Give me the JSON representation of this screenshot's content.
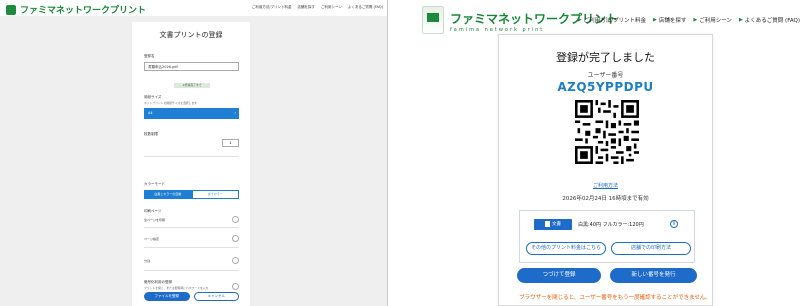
{
  "left": {
    "logo": "ファミマネットワークプリント",
    "nav": [
      "ご利用方法/プリント料金",
      "店舗を探す",
      "ご利用シーン",
      "よくあるご質問 (FAQ)"
    ],
    "title": "文書プリントの登録",
    "file_label": "登録名",
    "file_value": "書類申込2026.pdf",
    "notice": "※登録完了まで",
    "paper_label": "用紙サイズ",
    "paper_hint": "ネットプリントの用紙サイズを選択します",
    "paper_value": "A4",
    "copies_label": "枚数制限",
    "copies_value": "1",
    "color_label": "カラーモード",
    "color_options": [
      "白黒とカラーの自動",
      "全てカラー"
    ],
    "page_label": "印刷ページ",
    "opt1": "全ページを印刷",
    "opt2": "ページ指定",
    "opt3": "分割",
    "privacy_label": "暗号化利用の登録",
    "privacy_hint": "プリントを開く、または閲覧時にパスワードを入力",
    "submit": "ファイルを登録",
    "cancel": "キャンセル"
  },
  "right": {
    "logo": "ファミマネットワークプリント",
    "logo_sub": "famima network print",
    "nav": [
      "ご利用方法/プリント料金",
      "店舗を探す",
      "ご利用シーン",
      "よくあるご質問 (FAQ)"
    ],
    "done": "登録が完了しました",
    "user_label": "ユーザー番号",
    "user_code": "AZQ5YPPDPU",
    "howto_link": "ご利用方法",
    "expiry": "2026年02月24日 16時頃まで有効",
    "doc_label": "文書",
    "price": "白黒:40円 フルカラー:120円",
    "info": "i",
    "other_price": "その他のプリント料金はこちら",
    "store_howto": "店舗での印刷方法",
    "continue_btn": "つづけて登録",
    "new_btn": "新しい番号を発行",
    "warning": "ブラウザーを閉じると、ユーザー番号をもう一度確認することができません。"
  }
}
